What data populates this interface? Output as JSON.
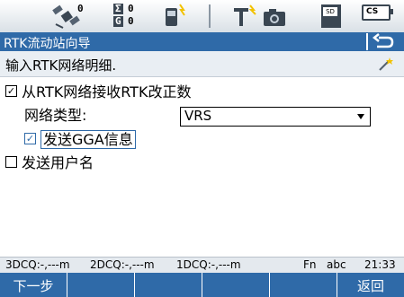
{
  "status": {
    "sat_gps": "0",
    "sat_glonass": "0",
    "sigma_label": "Σ",
    "g_label": "G",
    "sd_label": "SD",
    "cs_label": "CS"
  },
  "title": "RTK流动站向导",
  "message": "输入RTK网络明细.",
  "options": {
    "receive_rtk": {
      "label": "从RTK网络接收RTK改正数",
      "checked": true
    },
    "network_type": {
      "label": "网络类型:",
      "value": "VRS"
    },
    "send_gga": {
      "label": "发送GGA信息",
      "checked": true
    },
    "send_user": {
      "label": "发送用户名",
      "checked": false
    }
  },
  "info": {
    "dcq3": "3DCQ:-,---m",
    "dcq2": "2DCQ:-,---m",
    "dcq1": "1DCQ:-,---m",
    "fn": "Fn",
    "abc": "abc",
    "time": "21:33"
  },
  "softkeys": {
    "f1": "下一步",
    "f6": "返回"
  }
}
